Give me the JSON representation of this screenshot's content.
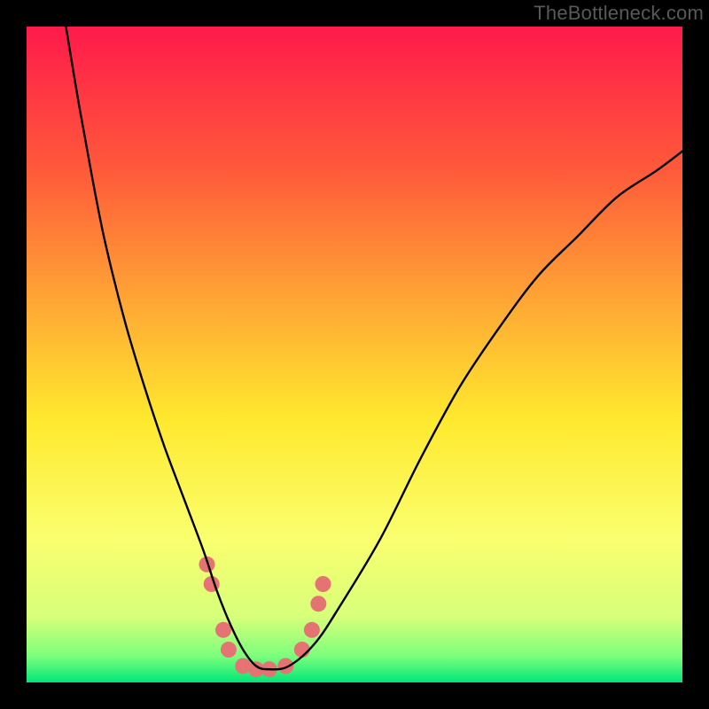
{
  "watermark": "TheBottleneck.com",
  "chart_data": {
    "type": "line",
    "title": "",
    "xlabel": "",
    "ylabel": "",
    "xlim": [
      0,
      100
    ],
    "ylim": [
      0,
      100
    ],
    "gradient_stops": [
      {
        "offset": 0,
        "color": "#ff1a4b"
      },
      {
        "offset": 0.22,
        "color": "#ff5a3a"
      },
      {
        "offset": 0.45,
        "color": "#ffb233"
      },
      {
        "offset": 0.6,
        "color": "#ffe92e"
      },
      {
        "offset": 0.78,
        "color": "#faff6e"
      },
      {
        "offset": 0.9,
        "color": "#d7ff7a"
      },
      {
        "offset": 0.96,
        "color": "#7cff7c"
      },
      {
        "offset": 1.0,
        "color": "#00e676"
      }
    ],
    "series": [
      {
        "name": "bottleneck-curve",
        "x": [
          6,
          8,
          10,
          12,
          15,
          18,
          21,
          24,
          27,
          29,
          31,
          33,
          35,
          37,
          40,
          44,
          48,
          54,
          60,
          66,
          72,
          78,
          84,
          90,
          96,
          100
        ],
        "y": [
          100,
          88,
          77,
          67,
          55,
          45,
          36,
          28,
          20,
          14,
          9,
          5,
          2.5,
          2,
          2.5,
          6,
          12,
          22,
          34,
          45,
          54,
          62,
          68,
          74,
          78,
          81
        ]
      }
    ],
    "markers": {
      "name": "highlight-dots",
      "points": [
        {
          "x": 27.5,
          "y": 18
        },
        {
          "x": 28.2,
          "y": 15
        },
        {
          "x": 30.0,
          "y": 8
        },
        {
          "x": 30.8,
          "y": 5
        },
        {
          "x": 33.0,
          "y": 2.5
        },
        {
          "x": 35.0,
          "y": 2
        },
        {
          "x": 37.0,
          "y": 2
        },
        {
          "x": 39.5,
          "y": 2.5
        },
        {
          "x": 42.0,
          "y": 5
        },
        {
          "x": 43.5,
          "y": 8
        },
        {
          "x": 44.5,
          "y": 12
        },
        {
          "x": 45.2,
          "y": 15
        }
      ],
      "radius": 9,
      "color": "#e57373"
    }
  }
}
